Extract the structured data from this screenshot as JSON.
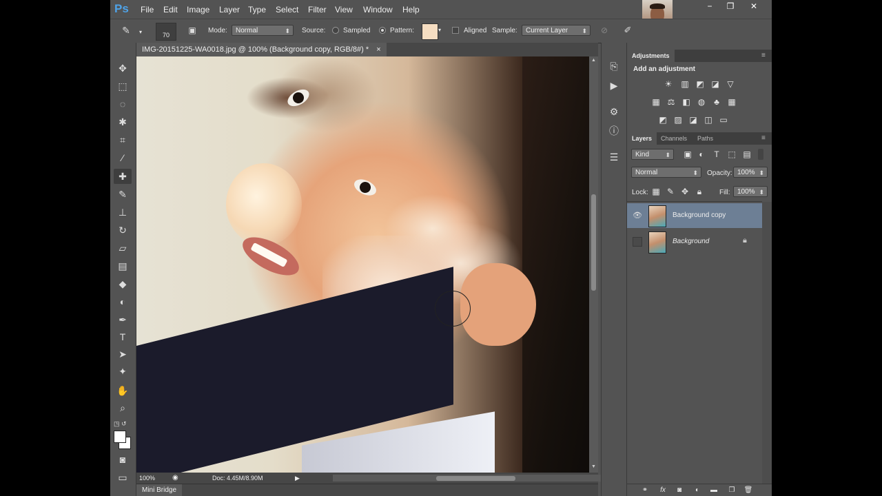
{
  "app": {
    "logo": "Ps"
  },
  "menubar": {
    "items": [
      "File",
      "Edit",
      "Image",
      "Layer",
      "Type",
      "Select",
      "Filter",
      "View",
      "Window",
      "Help"
    ]
  },
  "window_controls": {
    "minimize": "−",
    "restore": "❐",
    "close": "✕"
  },
  "options": {
    "brush_size": "70",
    "mode_label": "Mode:",
    "mode_value": "Normal",
    "source_label": "Source:",
    "sampled_label": "Sampled",
    "pattern_label": "Pattern:",
    "aligned_label": "Aligned",
    "sample_label": "Sample:",
    "sample_value": "Current Layer"
  },
  "document": {
    "tab_title": "IMG-20151225-WA0018.jpg @ 100% (Background copy, RGB/8#) *",
    "tab_close": "×",
    "zoom": "100%",
    "doc_size": "Doc: 4.45M/8.90M"
  },
  "bottom": {
    "mini_bridge": "Mini Bridge"
  },
  "adjustments": {
    "tab": "Adjustments",
    "title": "Add an adjustment"
  },
  "layers_panel": {
    "tabs": [
      "Layers",
      "Channels",
      "Paths"
    ],
    "kind_label": "Kind",
    "blend_mode": "Normal",
    "opacity_label": "Opacity:",
    "opacity_value": "100%",
    "lock_label": "Lock:",
    "fill_label": "Fill:",
    "fill_value": "100%",
    "layers": [
      {
        "name": "Background copy",
        "selected": true,
        "visible": true
      },
      {
        "name": "Background",
        "selected": false,
        "visible": false,
        "locked": true
      }
    ]
  },
  "colors": {
    "accent": "#4fa3e8",
    "panel": "#535353",
    "selection": "#6d7f95"
  }
}
